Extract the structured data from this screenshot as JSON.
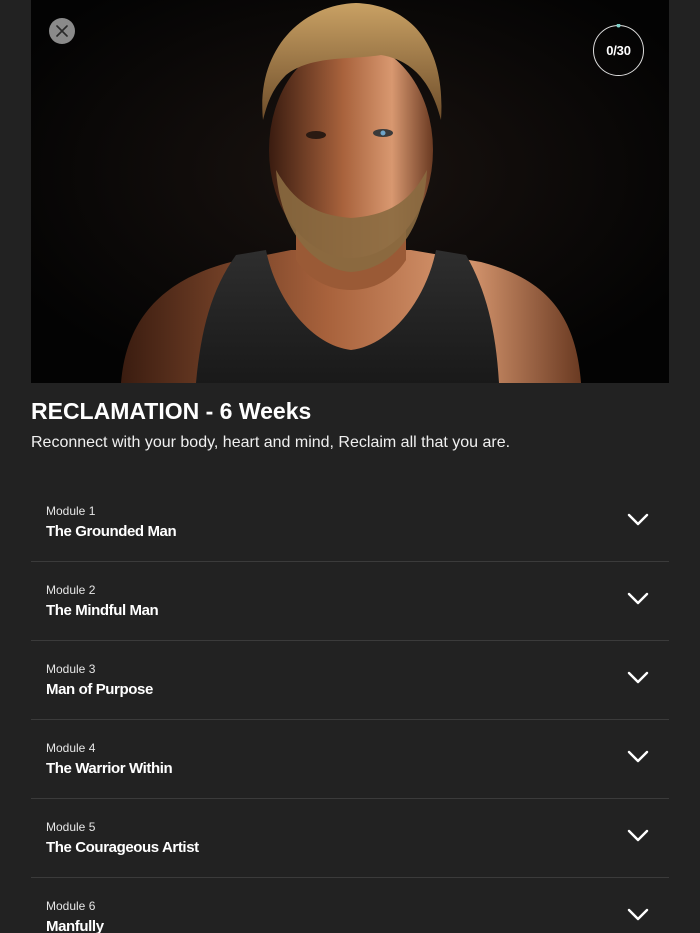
{
  "header": {
    "close_icon": "close-icon",
    "progress": {
      "completed": 0,
      "total": 30,
      "label": "0/30"
    }
  },
  "course": {
    "title": "RECLAMATION - 6 Weeks",
    "subtitle": "Reconnect with your body, heart and mind, Reclaim all that you are."
  },
  "modules": [
    {
      "number": "Module 1",
      "name": "The Grounded Man",
      "icon": "chevron-down-icon"
    },
    {
      "number": "Module 2",
      "name": "The Mindful Man",
      "icon": "chevron-down-icon"
    },
    {
      "number": "Module 3",
      "name": "Man of Purpose",
      "icon": "chevron-down-icon"
    },
    {
      "number": "Module 4",
      "name": "The Warrior Within",
      "icon": "chevron-down-icon"
    },
    {
      "number": "Module 5",
      "name": "The Courageous Artist",
      "icon": "chevron-down-icon"
    },
    {
      "number": "Module 6",
      "name": "Manfully",
      "icon": "chevron-down-icon"
    }
  ],
  "colors": {
    "background": "#222222",
    "text": "#ffffff",
    "progress_accent": "#7fd1c9",
    "close_button": "#8a8a8a"
  }
}
